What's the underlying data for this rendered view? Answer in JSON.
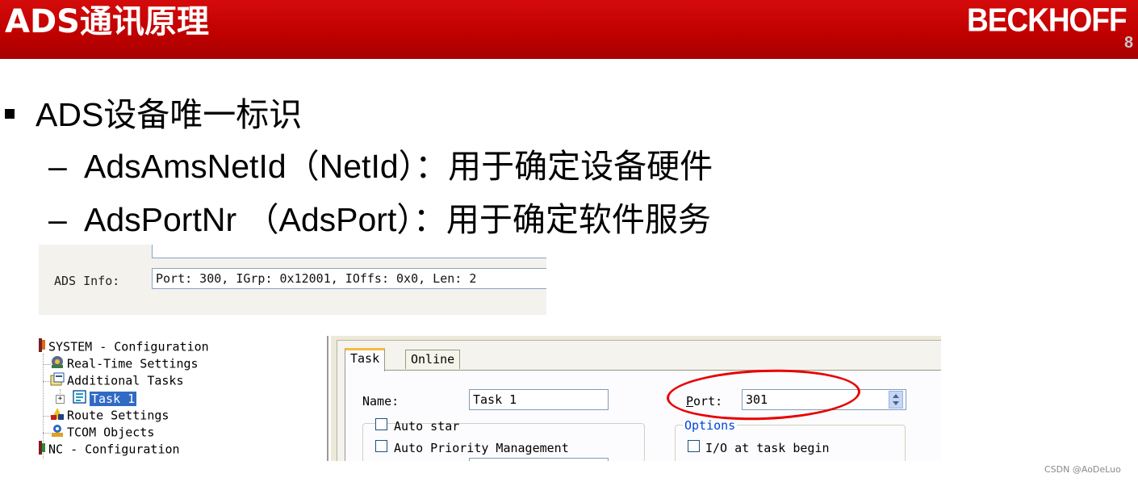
{
  "header": {
    "title": "ADS通讯原理",
    "logo": "BECKHOFF",
    "page_number": "8"
  },
  "bullets": {
    "main": "ADS设备唯一标识",
    "sub": [
      {
        "dash": "–",
        "text": "AdsAmsNetId（NetId）：用于确定设备硬件"
      },
      {
        "dash": "–",
        "text": "AdsPortNr （AdsPort）：用于确定软件服务"
      }
    ]
  },
  "ads_info": {
    "label": "ADS Info:",
    "value": "Port: 300, IGrp: 0x12001, IOffs: 0x0, Len: 2"
  },
  "tree": {
    "items": [
      {
        "label": "SYSTEM - Configuration",
        "icon": "system-config-icon"
      },
      {
        "label": "Real-Time Settings",
        "icon": "realtime-gear-icon"
      },
      {
        "label": "Additional Tasks",
        "icon": "additional-tasks-icon"
      },
      {
        "label": "Task 1",
        "icon": "task-icon",
        "selected": true,
        "expander": "+"
      },
      {
        "label": "Route Settings",
        "icon": "route-settings-icon"
      },
      {
        "label": "TCOM Objects",
        "icon": "tcom-objects-icon"
      },
      {
        "label": "NC - Configuration",
        "icon": "nc-config-icon"
      }
    ]
  },
  "task_panel": {
    "tabs": [
      {
        "label": "Task",
        "active": true
      },
      {
        "label": "Online",
        "active": false
      }
    ],
    "name_label": "Name:",
    "name_value": "Task 1",
    "port_label_prefix": "P",
    "port_label_rest": "ort:",
    "port_value": "301",
    "auto_start_label": "Auto star",
    "auto_priority_label": "Auto Priority Management",
    "options_title": "Options",
    "io_label": "I/O at task begin"
  },
  "colors": {
    "header_red": "#c10000",
    "highlight_ellipse": "#e80000",
    "selection_blue": "#316ac5",
    "options_blue": "#0046d5"
  },
  "watermark": "CSDN @AoDeLuo"
}
